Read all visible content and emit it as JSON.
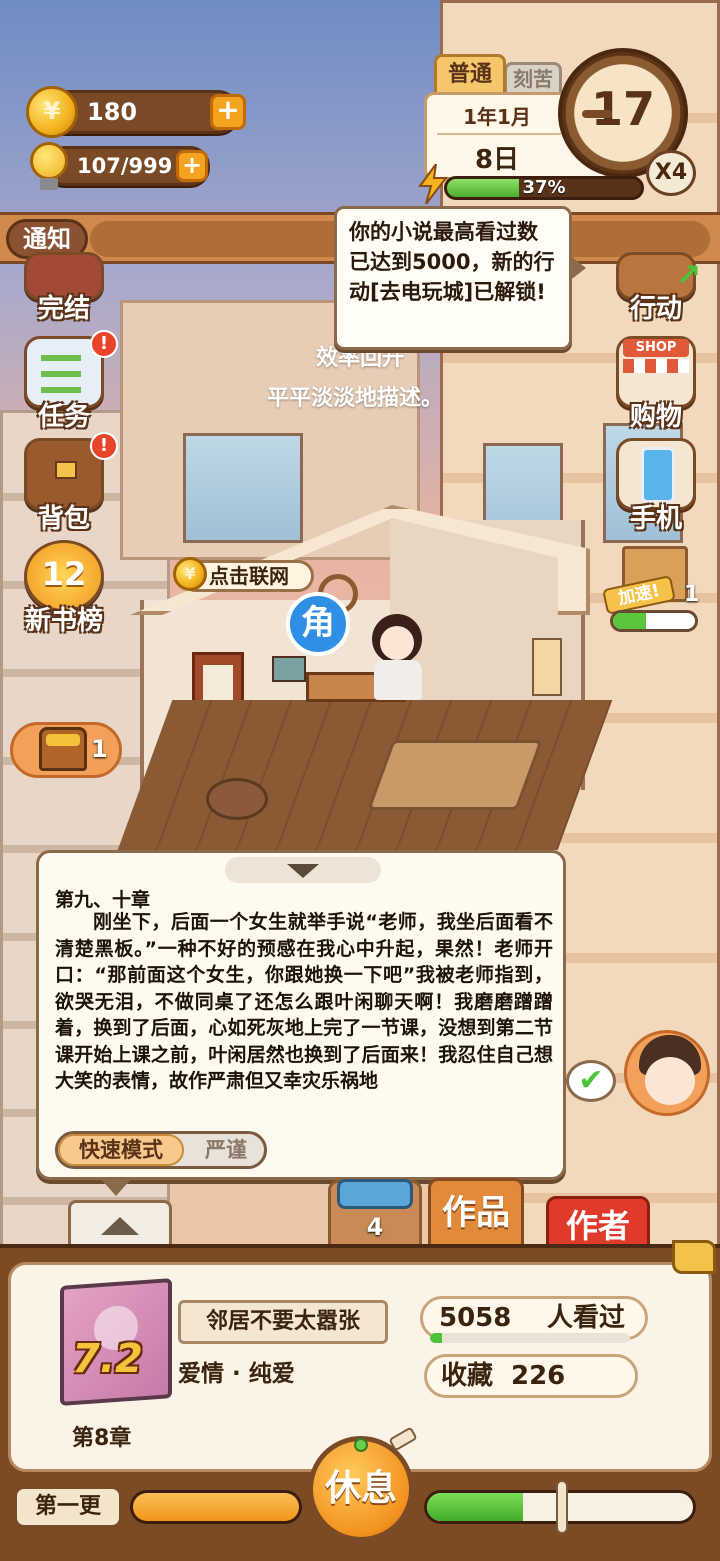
{
  "hud": {
    "coins": "180",
    "coin_symbol": "¥",
    "energy": "107/999",
    "mode_active": "普通",
    "mode_other": "刻苦",
    "date_year_month": "1年1月",
    "date_day": "8日",
    "clock_hour": "17",
    "speed": "X4",
    "stamina_percent": "37%",
    "stamina_value": 0.37
  },
  "notice": {
    "label": "通知",
    "tooltip": "你的小说最高看过数已达到5000，新的行动[去电玩城]已解锁!"
  },
  "left_menu": [
    {
      "label": "完结",
      "icon": "book-icon",
      "alert": false
    },
    {
      "label": "任务",
      "icon": "clipboard-icon",
      "alert": true
    },
    {
      "label": "背包",
      "icon": "backpack-icon",
      "alert": true
    },
    {
      "label": "新书榜",
      "icon": "rank-medal-icon",
      "badge": "12"
    }
  ],
  "right_menu": [
    {
      "label": "行动",
      "icon": "door-icon"
    },
    {
      "label": "购物",
      "icon": "shop-icon",
      "sign": "SHOP"
    },
    {
      "label": "手机",
      "icon": "phone-icon"
    }
  ],
  "float_text": {
    "line1": "效率回升",
    "line2": "平平淡淡地描述。"
  },
  "room": {
    "net_label": "点击联网",
    "role_label": "角"
  },
  "chest": {
    "count": "1"
  },
  "speedup": {
    "label": "加速!",
    "count": "1",
    "progress": 0.4
  },
  "novel": {
    "chapter_title": "第九、十章",
    "body": "刚坐下，后面一个女生就举手说“老师，我坐后面看不清楚黑板。”一种不好的预感在我心中升起，果然！老师开口：“那前面这个女生，你跟她换一下吧”我被老师指到，欲哭无泪，不做同桌了还怎么跟叶闲聊天啊！我磨磨蹭蹭着，换到了后面，心如死灰地上完了一节课，没想到第二节课开始上课之前，叶闲居然也换到了后面来！我忍住自己想大笑的表情，故作严肃但又幸灾乐祸地",
    "mode_fast": "快速模式",
    "mode_strict": "严谨"
  },
  "tabs": {
    "four_count": "4",
    "works": "作品",
    "author": "作者"
  },
  "book": {
    "score": "7.2",
    "title": "邻居不要太嚣张",
    "genre": "爱情 · 纯爱",
    "chapter": "第8章",
    "views": "5058",
    "views_label": "人看过",
    "views_progress": 0.06,
    "favorites_label": "收藏",
    "favorites": "226"
  },
  "controls": {
    "update_label": "第一更",
    "left_progress": 1.0,
    "rest_label": "休息",
    "right_progress": 0.36
  },
  "colors": {
    "brown_dark": "#7b4b26",
    "accent_orange": "#f3921f",
    "progress_green": "#4cae2e",
    "alert_red": "#e8442a",
    "role_blue": "#2f8fe4"
  }
}
